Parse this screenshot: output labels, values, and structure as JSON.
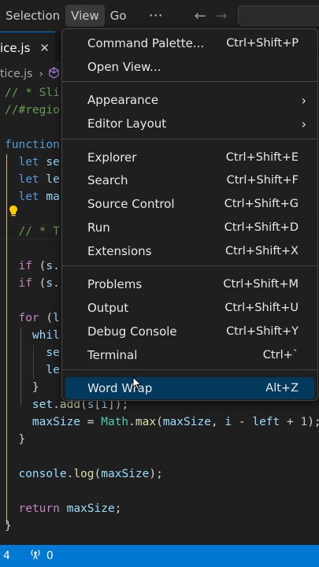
{
  "menubar": {
    "items": [
      "Selection",
      "View",
      "Go"
    ],
    "more": "⋯",
    "back": "←",
    "forward": "→"
  },
  "tab": {
    "label": "ice.js",
    "close": "✕"
  },
  "breadcrumb": {
    "file": "tice.js",
    "sep": "›"
  },
  "code": {
    "lines": [
      "// * Sli",
      "//#regio",
      "",
      "function",
      "  let se",
      "  let le",
      "  let ma",
      "",
      "  // * T",
      "",
      "  if (s.",
      "  if (s.",
      "",
      "  for (l",
      "    whil",
      "      se",
      "      le",
      "    }",
      "    set.add(s[i]);",
      "    maxSize = Math.max(maxSize, i - left + 1);",
      "  }",
      "",
      "  console.log(maxSize);",
      "",
      "  return maxSize;",
      "}"
    ]
  },
  "view_menu": {
    "groups": [
      [
        {
          "label": "Command Palette...",
          "shortcut": "Ctrl+Shift+P"
        },
        {
          "label": "Open View...",
          "shortcut": ""
        }
      ],
      [
        {
          "label": "Appearance",
          "shortcut": "",
          "submenu": true
        },
        {
          "label": "Editor Layout",
          "shortcut": "",
          "submenu": true
        }
      ],
      [
        {
          "label": "Explorer",
          "shortcut": "Ctrl+Shift+E"
        },
        {
          "label": "Search",
          "shortcut": "Ctrl+Shift+F"
        },
        {
          "label": "Source Control",
          "shortcut": "Ctrl+Shift+G"
        },
        {
          "label": "Run",
          "shortcut": "Ctrl+Shift+D"
        },
        {
          "label": "Extensions",
          "shortcut": "Ctrl+Shift+X"
        }
      ],
      [
        {
          "label": "Problems",
          "shortcut": "Ctrl+Shift+M"
        },
        {
          "label": "Output",
          "shortcut": "Ctrl+Shift+U"
        },
        {
          "label": "Debug Console",
          "shortcut": "Ctrl+Shift+Y"
        },
        {
          "label": "Terminal",
          "shortcut": "Ctrl+`"
        }
      ],
      [
        {
          "label": "Word Wrap",
          "shortcut": "Alt+Z",
          "selected": true
        }
      ]
    ]
  },
  "statusbar": {
    "left": "4",
    "ports": "0"
  },
  "colors": {
    "accent": "#0078d4",
    "menu_selected": "#04395e",
    "keyword": "#569cd6",
    "comment": "#6a9955",
    "function": "#dcdcaa",
    "variable": "#9cdcfe",
    "number": "#b5cea8",
    "control": "#c586c0"
  }
}
